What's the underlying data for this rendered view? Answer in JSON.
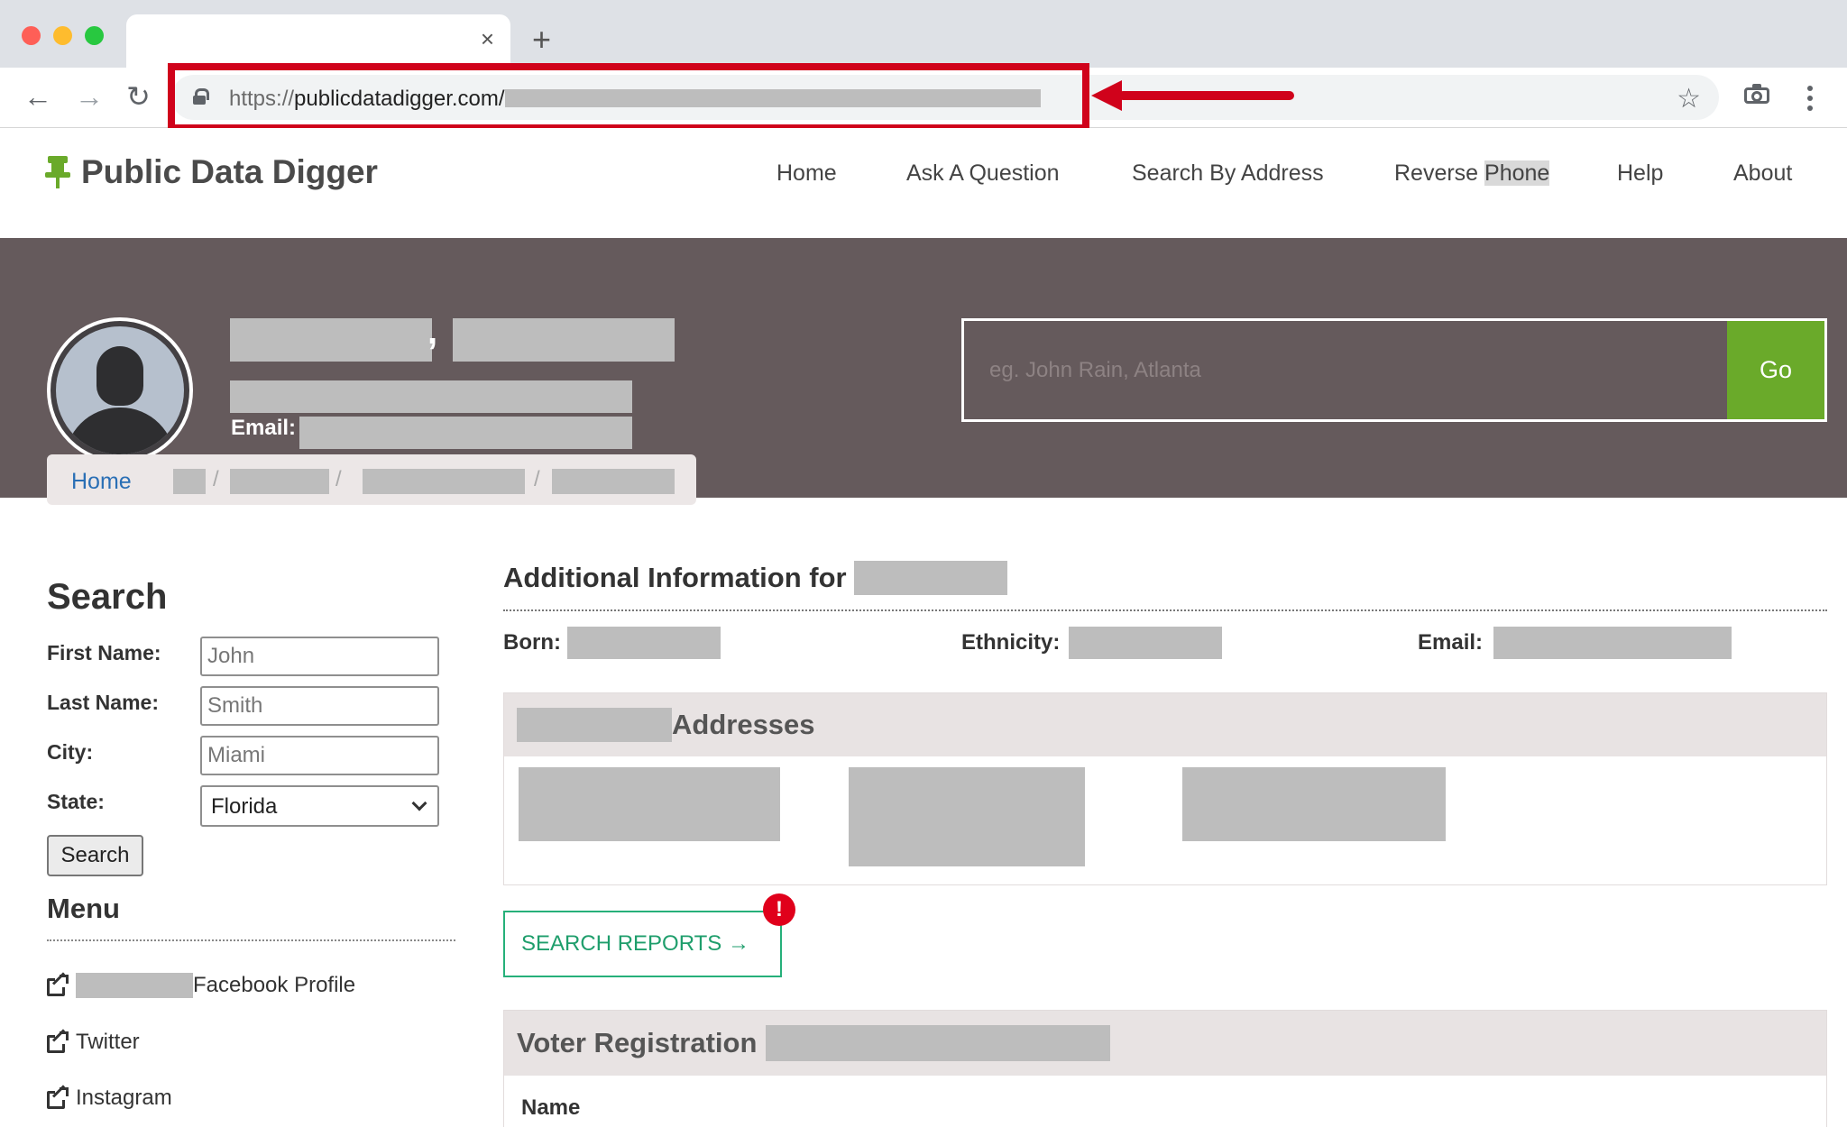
{
  "browser": {
    "tab_close": "×",
    "new_tab": "+",
    "back": "←",
    "forward": "→",
    "reload": "↻",
    "url_scheme": "https://",
    "url_host": "publicdatadigger.com/",
    "bookmark": "☆"
  },
  "site": {
    "logo": "Public Data Digger",
    "nav": [
      "Home",
      "Ask A Question",
      "Search By Address",
      "Reverse ",
      "Phone",
      "Help",
      "About"
    ]
  },
  "banner": {
    "email_label": "Email:",
    "search_placeholder": "eg. John Rain, Atlanta",
    "go_label": "Go",
    "comma": ",",
    "breadcrumb_home": "Home",
    "breadcrumb_sep": "/"
  },
  "sidebar": {
    "search_heading": "Search",
    "first_name_label": "First Name:",
    "first_name_placeholder": "John",
    "last_name_label": "Last Name:",
    "last_name_placeholder": "Smith",
    "city_label": "City:",
    "city_placeholder": "Miami",
    "state_label": "State:",
    "state_value": "Florida",
    "search_button": "Search",
    "menu_heading": "Menu",
    "menu_links": [
      "Facebook Profile",
      "Twitter",
      "Instagram"
    ]
  },
  "main": {
    "additional_heading": "Additional Information for",
    "born_label": "Born:",
    "ethnicity_label": "Ethnicity:",
    "email_label": "Email:",
    "addresses_title": "Addresses",
    "reports_button": "SEARCH REPORTS →",
    "alert_mark": "!",
    "voter_title": "Voter Registration",
    "name_label": "Name"
  },
  "colors": {
    "brand_green": "#6aaa2a",
    "banner_bg": "#655a5c",
    "annotation_red": "#d0021b",
    "link_blue": "#2a6fb5",
    "reports_green": "#1f9e6c"
  }
}
